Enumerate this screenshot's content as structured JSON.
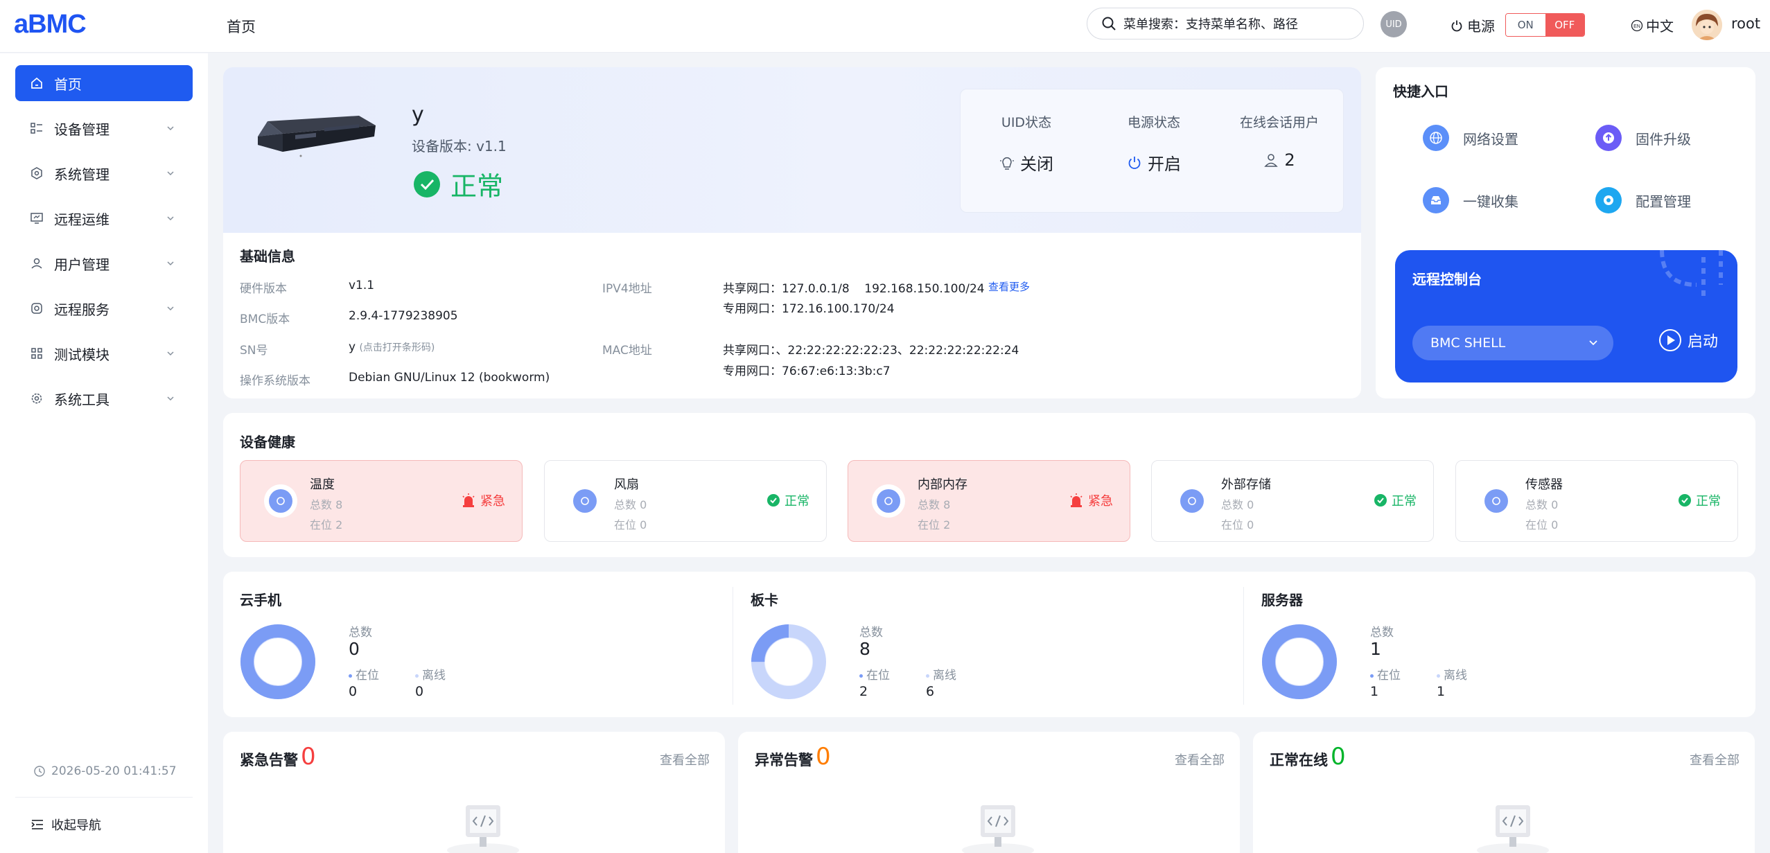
{
  "app": {
    "logo": "aBMC",
    "page_title": "首页"
  },
  "header": {
    "search_placeholder": "菜单搜索：支持菜单名称、路径",
    "uid_label": "UID",
    "power_label": "电源",
    "power_on": "ON",
    "power_off": "OFF",
    "language": "中文",
    "username": "root"
  },
  "sidebar": {
    "items": [
      {
        "label": "首页",
        "icon": "home-icon",
        "active": true
      },
      {
        "label": "设备管理",
        "icon": "list-icon"
      },
      {
        "label": "系统管理",
        "icon": "hexagon-icon"
      },
      {
        "label": "远程运维",
        "icon": "monitor-icon"
      },
      {
        "label": "用户管理",
        "icon": "user-icon"
      },
      {
        "label": "远程服务",
        "icon": "service-icon"
      },
      {
        "label": "测试模块",
        "icon": "grid-icon"
      },
      {
        "label": "系统工具",
        "icon": "gear-icon"
      }
    ],
    "datetime": "2026-05-20 01:41:57",
    "collapse_label": "收起导航"
  },
  "device": {
    "name": "y",
    "version": "设备版本: v1.1",
    "status": "正常",
    "uid_state_label": "UID状态",
    "uid_state": "关闭",
    "power_state_label": "电源状态",
    "power_state": "开启",
    "sessions_label": "在线会话用户",
    "sessions": "2"
  },
  "basic_info": {
    "title": "基础信息",
    "hw_label": "硬件版本",
    "hw": "v1.1",
    "bmc_label": "BMC版本",
    "bmc": "2.9.4-1779238905",
    "sn_label": "SN号",
    "sn": "y",
    "sn_hint": "(点击打开条形码)",
    "os_label": "操作系统版本",
    "os": "Debian GNU/Linux 12 (bookworm)",
    "ipv4_label": "IPV4地址",
    "ipv4_shared": "共享网口：127.0.0.1/8    192.168.150.100/24",
    "ipv4_private": "专用网口：172.16.100.170/24",
    "see_more": "查看更多",
    "mac_label": "MAC地址",
    "mac_shared": "共享网口：、22:22:22:22:22:23、22:22:22:22:22:24",
    "mac_private": "专用网口：76:67:e6:13:3b:c7"
  },
  "quick": {
    "title": "快捷入口",
    "items": [
      {
        "label": "网络设置",
        "icon": "globe-icon",
        "color": "#5b8ff9"
      },
      {
        "label": "固件升级",
        "icon": "upload-icon",
        "color": "#6b5cf6"
      },
      {
        "label": "一键收集",
        "icon": "inbox-icon",
        "color": "#5b8ff9"
      },
      {
        "label": "配置管理",
        "icon": "gear-icon",
        "color": "#1ea7f0"
      }
    ]
  },
  "console": {
    "title": "远程控制台",
    "selected": "BMC SHELL",
    "start_label": "启动"
  },
  "health": {
    "title": "设备健康",
    "items": [
      {
        "name": "温度",
        "total": "总数 8",
        "present": "在位 2",
        "status": "紧急",
        "alert": true
      },
      {
        "name": "风扇",
        "total": "总数 0",
        "present": "在位 0",
        "status": "正常",
        "alert": false
      },
      {
        "name": "内部内存",
        "total": "总数 8",
        "present": "在位 2",
        "status": "紧急",
        "alert": true
      },
      {
        "name": "外部存储",
        "total": "总数 0",
        "present": "在位 0",
        "status": "正常",
        "alert": false
      },
      {
        "name": "传感器",
        "total": "总数 0",
        "present": "在位 0",
        "status": "正常",
        "alert": false
      }
    ]
  },
  "inventory": [
    {
      "title": "云手机",
      "total_label": "总数",
      "total": "0",
      "online_label": "在位",
      "online": "0",
      "offline_label": "离线",
      "offline": "0",
      "online_fraction": 1.0
    },
    {
      "title": "板卡",
      "total_label": "总数",
      "total": "8",
      "online_label": "在位",
      "online": "2",
      "offline_label": "离线",
      "offline": "6",
      "online_fraction": 0.25
    },
    {
      "title": "服务器",
      "total_label": "总数",
      "total": "1",
      "online_label": "在位",
      "online": "1",
      "offline_label": "离线",
      "offline": "1",
      "online_fraction": 1.0
    }
  ],
  "alarms": [
    {
      "title": "紧急告警",
      "count": "0",
      "color": "#f53f3f",
      "see_all": "查看全部"
    },
    {
      "title": "异常告警",
      "count": "0",
      "color": "#ff7d00",
      "see_all": "查看全部"
    },
    {
      "title": "正常在线",
      "count": "0",
      "color": "#00b42a",
      "see_all": "查看全部"
    }
  ],
  "colors": {
    "accent": "#1f5bf0",
    "ok": "#18b566",
    "danger": "#f53f3f",
    "donut": "#7b9cf5",
    "donut_light": "#c8d6fb"
  }
}
